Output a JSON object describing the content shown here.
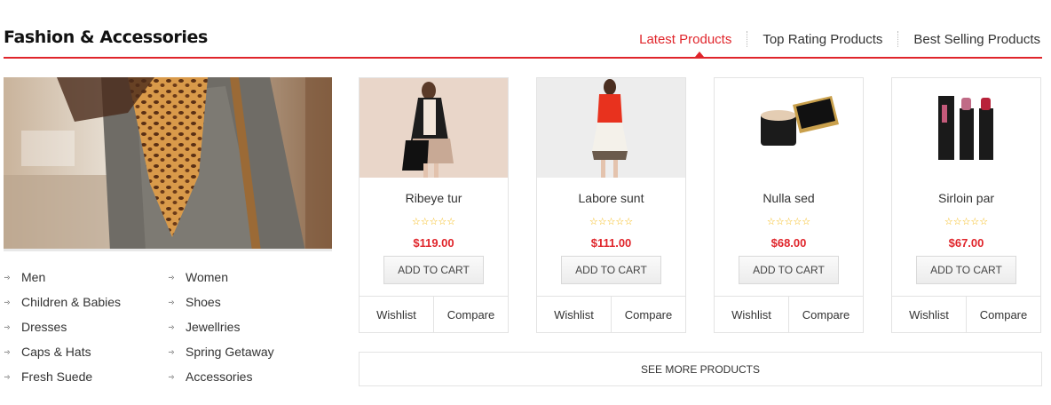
{
  "section": {
    "title": "Fashion & Accessories",
    "accent_color": "#e0252b"
  },
  "tabs": [
    {
      "label": "Latest Products",
      "active": true
    },
    {
      "label": "Top Rating Products",
      "active": false
    },
    {
      "label": "Best Selling Products",
      "active": false
    }
  ],
  "categories": {
    "left": [
      "Men",
      "Children & Babies",
      "Dresses",
      "Caps & Hats",
      "Fresh Suede"
    ],
    "right": [
      "Women",
      "Shoes",
      "Jewellries",
      "Spring Getaway",
      "Accessories"
    ]
  },
  "products": [
    {
      "name": "Ribeye tur",
      "price": "$119.00",
      "stars": "☆☆☆☆☆",
      "cart_label": "ADD TO CART",
      "wishlist_label": "Wishlist",
      "compare_label": "Compare",
      "image": "woman-with-handbag"
    },
    {
      "name": "Labore sunt",
      "price": "$111.00",
      "stars": "☆☆☆☆☆",
      "cart_label": "ADD TO CART",
      "wishlist_label": "Wishlist",
      "compare_label": "Compare",
      "image": "woman-in-red-dress"
    },
    {
      "name": "Nulla sed",
      "price": "$68.00",
      "stars": "☆☆☆☆☆",
      "cart_label": "ADD TO CART",
      "wishlist_label": "Wishlist",
      "compare_label": "Compare",
      "image": "face-powder-compact"
    },
    {
      "name": "Sirloin par",
      "price": "$67.00",
      "stars": "☆☆☆☆☆",
      "cart_label": "ADD TO CART",
      "wishlist_label": "Wishlist",
      "compare_label": "Compare",
      "image": "lipsticks"
    }
  ],
  "see_more_label": "SEE MORE PRODUCTS"
}
